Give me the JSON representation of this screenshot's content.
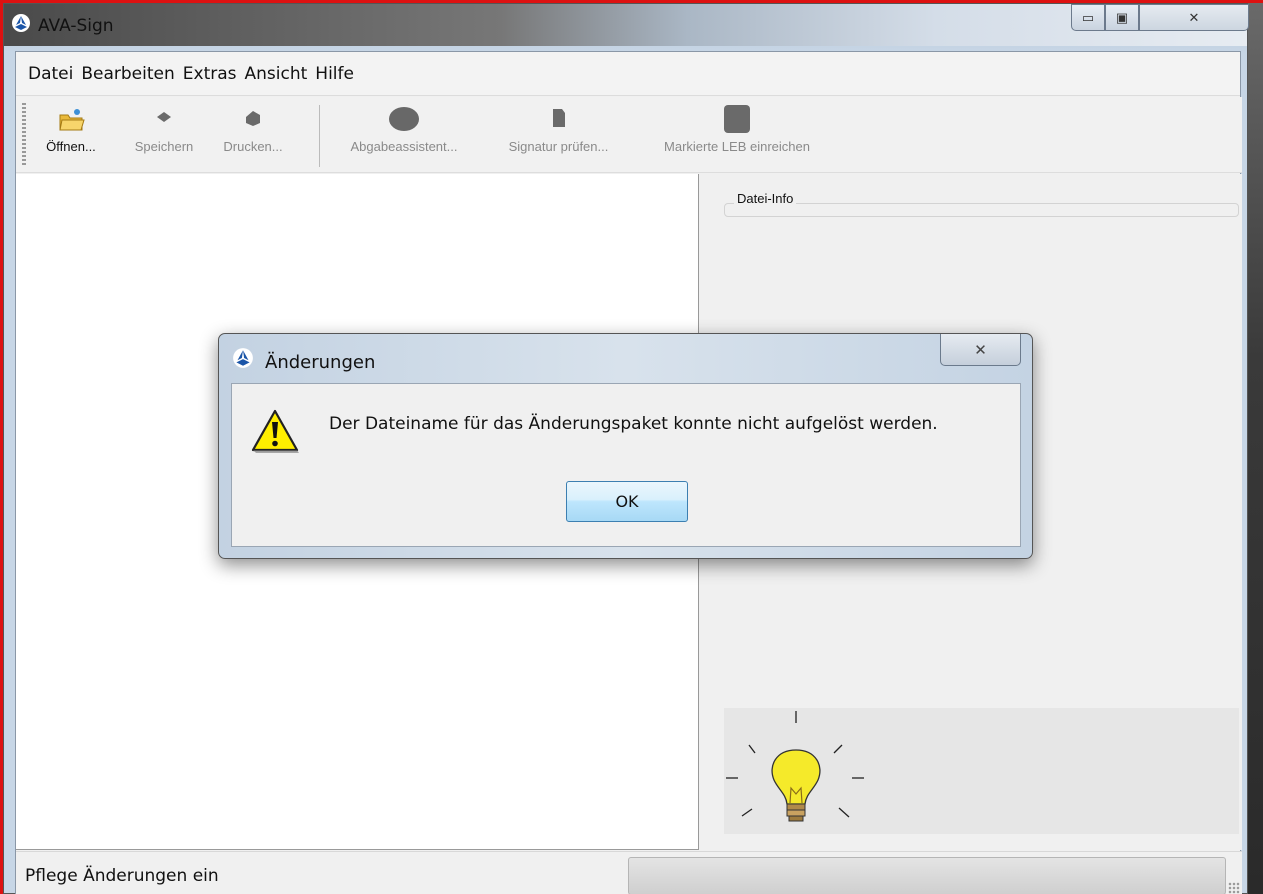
{
  "window": {
    "title": "AVA-Sign",
    "controls": {
      "minimize": "▭",
      "maximize": "▣",
      "close": "✕"
    }
  },
  "menu": [
    "Datei",
    "Bearbeiten",
    "Extras",
    "Ansicht",
    "Hilfe"
  ],
  "toolbar": {
    "open": "Öffnen...",
    "save": "Speichern",
    "print": "Drucken...",
    "wizard": "Abgabeassistent...",
    "verify": "Signatur prüfen...",
    "submit": "Markierte LEB einreichen"
  },
  "info_panel": {
    "group_label": "Datei-Info"
  },
  "status": {
    "text": "Pflege Änderungen ein",
    "progress": 0
  },
  "dialog": {
    "title": "Änderungen",
    "close": "✕",
    "message": "Der Dateiname für das Änderungspaket konnte nicht aufgelöst werden.",
    "ok": "OK"
  },
  "colors": {
    "warning": "#ffee00",
    "bulb": "#f5ea2a",
    "accent_frame": "#dd1111"
  }
}
